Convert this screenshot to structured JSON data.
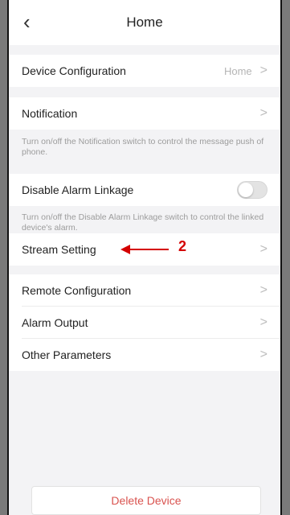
{
  "header": {
    "back_icon": "chevron-left-icon",
    "title": "Home"
  },
  "device_configuration": {
    "label": "Device Configuration",
    "value": "Home"
  },
  "notification": {
    "label": "Notification",
    "description": "Turn on/off the Notification switch to control the message push of phone."
  },
  "disable_alarm_linkage": {
    "label": "Disable Alarm Linkage",
    "toggle_on": false,
    "description": "Turn on/off the Disable Alarm Linkage switch to control the linked device's alarm."
  },
  "stream_setting": {
    "label": "Stream Setting"
  },
  "annotation": {
    "number": "2",
    "color": "#d40000"
  },
  "menu": [
    {
      "label": "Remote Configuration"
    },
    {
      "label": "Alarm Output"
    },
    {
      "label": "Other Parameters"
    }
  ],
  "chevron": ">",
  "delete_button": {
    "label": "Delete Device",
    "color": "#d9534f"
  }
}
